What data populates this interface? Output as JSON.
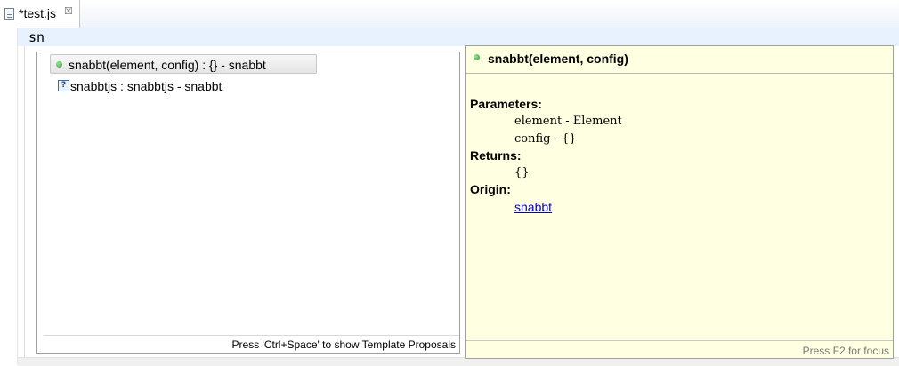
{
  "editor": {
    "tab": {
      "label": "*test.js",
      "close_glyph": "☒"
    },
    "code_line": "sn"
  },
  "proposals": {
    "items": [
      {
        "label": "snabbt(element, config) : {} - snabbt",
        "icon": "green-dot-method-icon",
        "selected": true
      },
      {
        "label": "snabbtjs : snabbtjs - snabbt",
        "icon": "unknown-type-icon",
        "selected": false
      }
    ],
    "status": "Press 'Ctrl+Space' to show Template Proposals"
  },
  "docs": {
    "title": "snabbt(element, config)",
    "parameters_label": "Parameters:",
    "params": [
      "element - Element",
      "config - {}"
    ],
    "returns_label": "Returns:",
    "returns": "{}",
    "origin_label": "Origin:",
    "origin_link": "snabbt",
    "footer": "Press F2 for focus"
  },
  "colors": {
    "current_line": "#e8f2fe",
    "doc_background": "#ffffe1",
    "link": "#0000cc"
  }
}
